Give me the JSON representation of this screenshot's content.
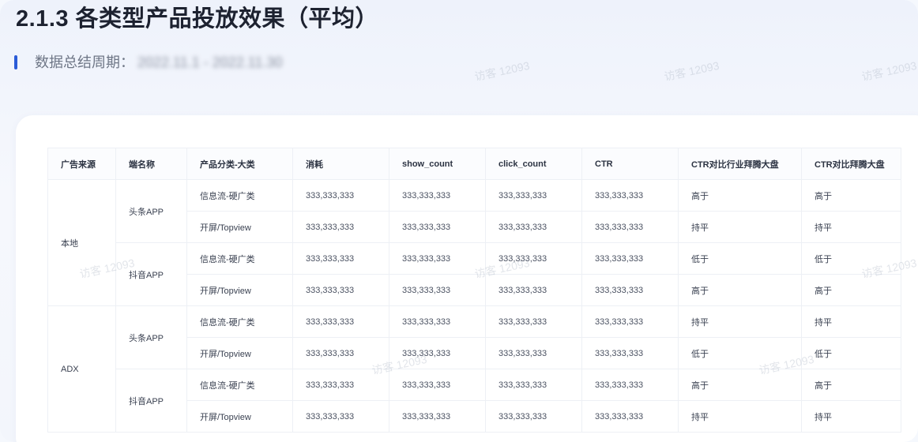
{
  "title": "2.1.3 各类型产品投放效果（平均）",
  "period": {
    "label": "数据总结周期：",
    "value": "2022.11.1 - 2022.11.30"
  },
  "watermark_text": "访客 12093",
  "table": {
    "headers": [
      "广告来源",
      "端名称",
      "产品分类-大类",
      "消耗",
      "show_count",
      "click_count",
      "CTR",
      "CTR对比行业拜腾大盘",
      "CTR对比拜腾大盘"
    ],
    "groups": [
      {
        "source": "本地",
        "apps": [
          {
            "name": "头条APP",
            "rows": [
              {
                "category": "信息流-硬广类",
                "cost": "333,333,333",
                "show": "333,333,333",
                "click": "333,333,333",
                "ctr": "333,333,333",
                "cmp_industry": "高于",
                "cmp_overall": "高于"
              },
              {
                "category": "开屏/Topview",
                "cost": "333,333,333",
                "show": "333,333,333",
                "click": "333,333,333",
                "ctr": "333,333,333",
                "cmp_industry": "持平",
                "cmp_overall": "持平"
              }
            ]
          },
          {
            "name": "抖音APP",
            "rows": [
              {
                "category": "信息流-硬广类",
                "cost": "333,333,333",
                "show": "333,333,333",
                "click": "333,333,333",
                "ctr": "333,333,333",
                "cmp_industry": "低于",
                "cmp_overall": "低于"
              },
              {
                "category": "开屏/Topview",
                "cost": "333,333,333",
                "show": "333,333,333",
                "click": "333,333,333",
                "ctr": "333,333,333",
                "cmp_industry": "高于",
                "cmp_overall": "高于"
              }
            ]
          }
        ]
      },
      {
        "source": "ADX",
        "apps": [
          {
            "name": "头条APP",
            "rows": [
              {
                "category": "信息流-硬广类",
                "cost": "333,333,333",
                "show": "333,333,333",
                "click": "333,333,333",
                "ctr": "333,333,333",
                "cmp_industry": "持平",
                "cmp_overall": "持平"
              },
              {
                "category": "开屏/Topview",
                "cost": "333,333,333",
                "show": "333,333,333",
                "click": "333,333,333",
                "ctr": "333,333,333",
                "cmp_industry": "低于",
                "cmp_overall": "低于"
              }
            ]
          },
          {
            "name": "抖音APP",
            "rows": [
              {
                "category": "信息流-硬广类",
                "cost": "333,333,333",
                "show": "333,333,333",
                "click": "333,333,333",
                "ctr": "333,333,333",
                "cmp_industry": "高于",
                "cmp_overall": "高于"
              },
              {
                "category": "开屏/Topview",
                "cost": "333,333,333",
                "show": "333,333,333",
                "click": "333,333,333",
                "ctr": "333,333,333",
                "cmp_industry": "持平",
                "cmp_overall": "持平"
              }
            ]
          }
        ]
      }
    ]
  }
}
